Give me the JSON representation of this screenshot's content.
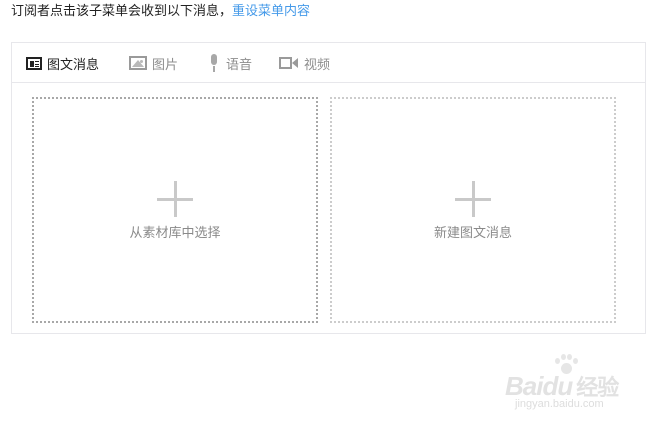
{
  "header": {
    "message": "订阅者点击该子菜单会收到以下消息，",
    "reset_link": "重设菜单内容"
  },
  "tabs": [
    {
      "label": "图文消息",
      "icon": "news-icon",
      "active": true
    },
    {
      "label": "图片",
      "icon": "image-icon",
      "active": false
    },
    {
      "label": "语音",
      "icon": "microphone-icon",
      "active": false
    },
    {
      "label": "视频",
      "icon": "video-icon",
      "active": false
    }
  ],
  "options": [
    {
      "label": "从素材库中选择",
      "icon": "plus-icon"
    },
    {
      "label": "新建图文消息",
      "icon": "plus-icon"
    }
  ],
  "watermark": {
    "brand": "Baidu",
    "brand_cn": "经验",
    "url": "jingyan.baidu.com"
  },
  "colors": {
    "link": "#459ae9",
    "active_tab": "#222222",
    "inactive_tab": "#8d8d8d",
    "border": "#e7e7eb"
  }
}
